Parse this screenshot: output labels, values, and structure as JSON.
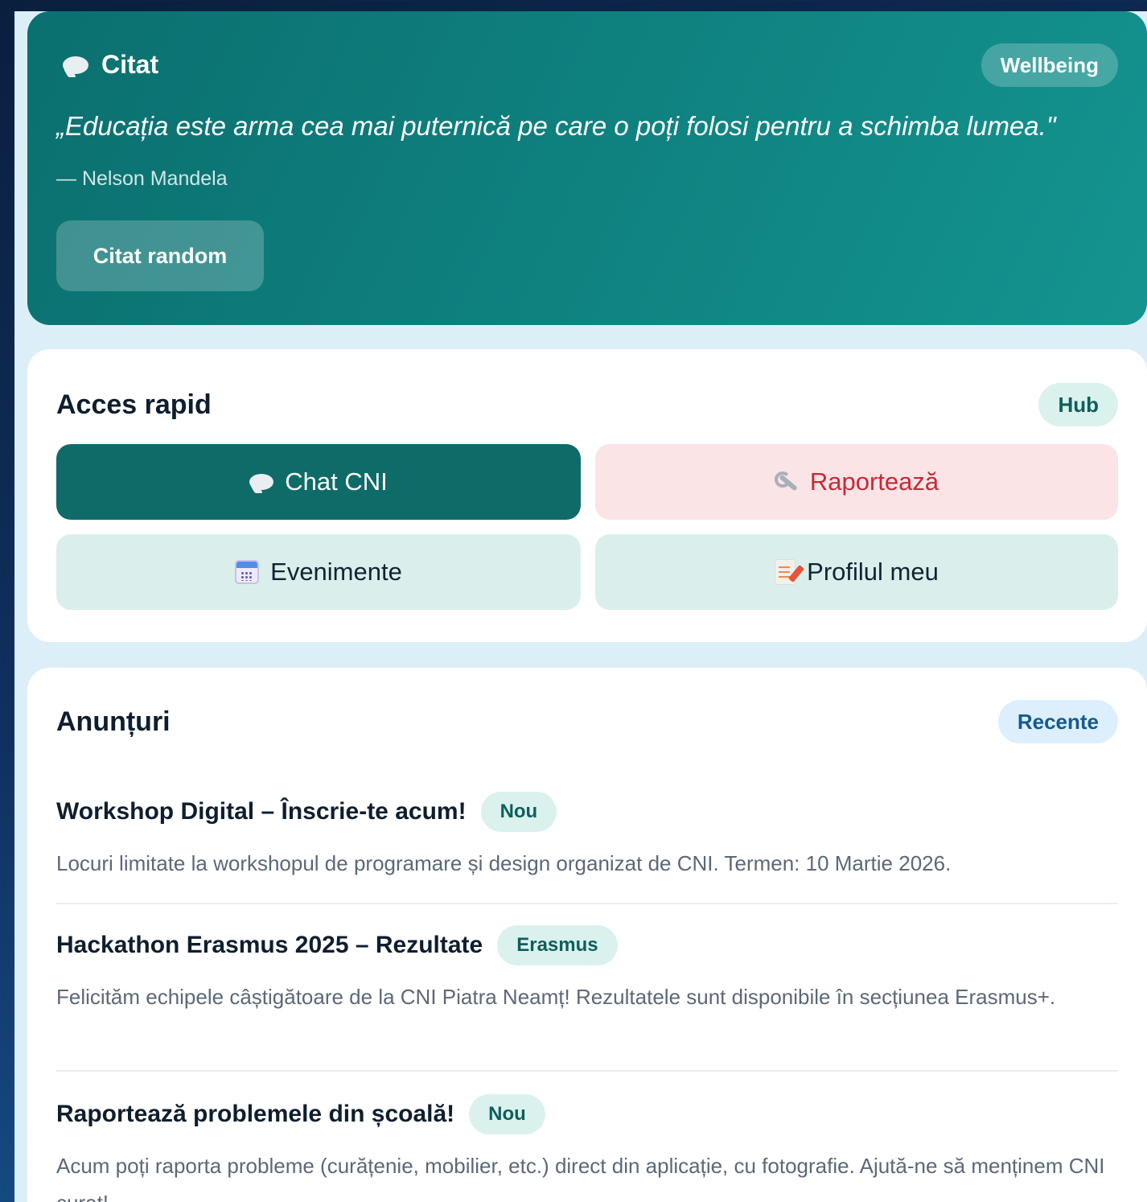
{
  "quote": {
    "title": "Citat",
    "badge": "Wellbeing",
    "text": "„Educația este arma cea mai puternică pe care o poți folosi pentru a schimba lumea.\"",
    "author": "— Nelson Mandela",
    "button_label": "Citat random",
    "icon": "speech-bubble-icon"
  },
  "quick_access": {
    "title": "Acces rapid",
    "badge": "Hub",
    "tiles": [
      {
        "label": "Chat CNI",
        "icon": "speech-bubble-icon"
      },
      {
        "label": "Raportează",
        "icon": "wrench-icon"
      },
      {
        "label": "Evenimente",
        "icon": "calendar-icon"
      },
      {
        "label": "Profilul meu",
        "icon": "memo-icon"
      }
    ]
  },
  "announcements": {
    "title": "Anunțuri",
    "badge": "Recente",
    "items": [
      {
        "title": "Workshop Digital – Înscrie-te acum!",
        "tag": "Nou",
        "body": "Locuri limitate la workshopul de programare și design organizat de CNI. Termen: 10 Martie 2026."
      },
      {
        "title": "Hackathon Erasmus 2025 – Rezultate",
        "tag": "Erasmus",
        "body": "Felicităm echipele câștigătoare de la CNI Piatra Neamț! Rezultatele sunt disponibile în secțiunea Erasmus+."
      },
      {
        "title": "Raportează problemele din școală!",
        "tag": "Nou",
        "body": "Acum poți raporta probleme (curățenie, mobilier, etc.) direct din aplicație, cu fotografie. Ajută-ne să menținem CNI curat!"
      }
    ]
  },
  "colors": {
    "primary_teal": "#0e6b68",
    "report_red": "#c62a33",
    "report_bg": "#fbe4e6",
    "tile_bg": "#daefeb"
  }
}
